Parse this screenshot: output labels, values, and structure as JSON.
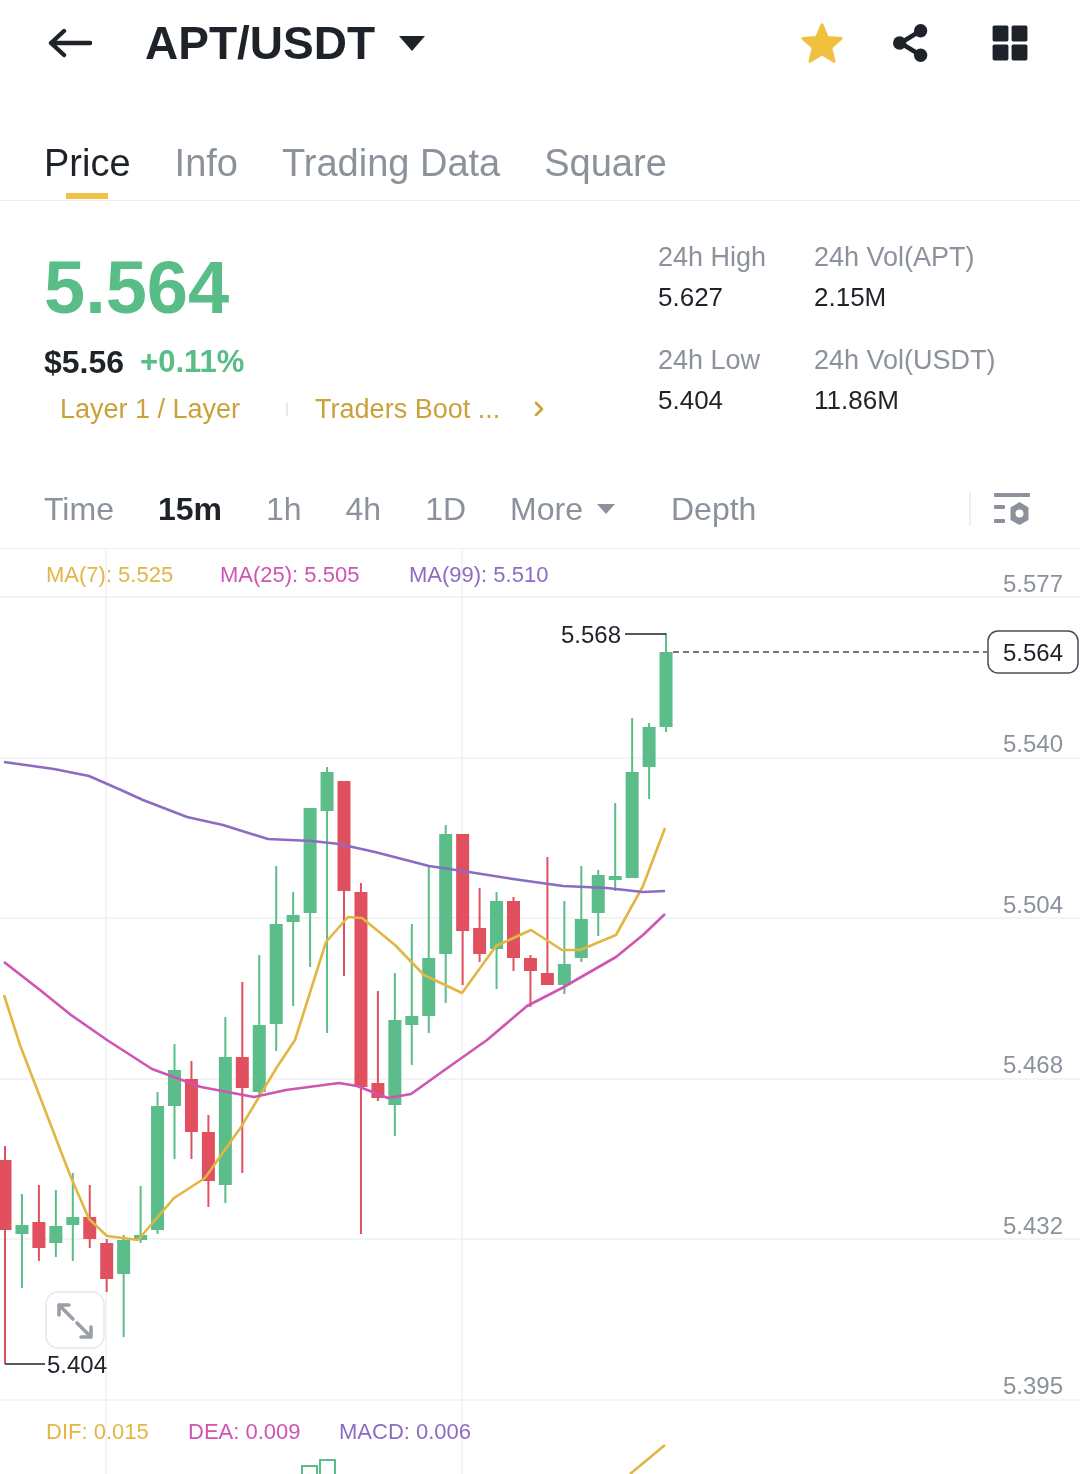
{
  "header": {
    "title": "APT/USDT",
    "favorite": true
  },
  "tabs": [
    {
      "label": "Price",
      "selected": true
    },
    {
      "label": "Info",
      "selected": false
    },
    {
      "label": "Trading Data",
      "selected": false
    },
    {
      "label": "Square",
      "selected": false
    }
  ],
  "ticker": {
    "last_price": "5.564",
    "fiat_price": "$5.56",
    "change": "+0.11%",
    "tags": [
      "Layer 1 / Layer",
      "Traders Boot ..."
    ]
  },
  "stats": [
    {
      "label": "24h High",
      "value": "5.627"
    },
    {
      "label": "24h Vol(APT)",
      "value": "2.15M"
    },
    {
      "label": "24h Low",
      "value": "5.404"
    },
    {
      "label": "24h Vol(USDT)",
      "value": "11.86M"
    }
  ],
  "intervals": [
    {
      "label": "Time",
      "kind": "option",
      "selected": false
    },
    {
      "label": "15m",
      "kind": "option",
      "selected": true
    },
    {
      "label": "1h",
      "kind": "option",
      "selected": false
    },
    {
      "label": "4h",
      "kind": "option",
      "selected": false
    },
    {
      "label": "1D",
      "kind": "option",
      "selected": false
    },
    {
      "label": "More",
      "kind": "menu",
      "selected": false
    },
    {
      "label": "Depth",
      "kind": "option",
      "selected": false
    }
  ],
  "chart": {
    "indicators": [
      {
        "label": "MA(7): 5.525",
        "color": "#e2b642"
      },
      {
        "label": "MA(25): 5.505",
        "color": "#cf54b3"
      },
      {
        "label": "MA(99): 5.510",
        "color": "#8c6cc2"
      }
    ],
    "price_axis": [
      "5.577",
      "5.540",
      "5.504",
      "5.468",
      "5.432",
      "5.395"
    ],
    "high_label": "5.568",
    "low_label": "5.404",
    "last_price_tag": "5.564"
  },
  "macd": {
    "indicators": [
      {
        "label": "DIF: 0.015",
        "color": "#e2b642"
      },
      {
        "label": "DEA: 0.009",
        "color": "#cf54b3"
      },
      {
        "label": "MACD: 0.006",
        "color": "#8c6cc2"
      }
    ]
  }
}
